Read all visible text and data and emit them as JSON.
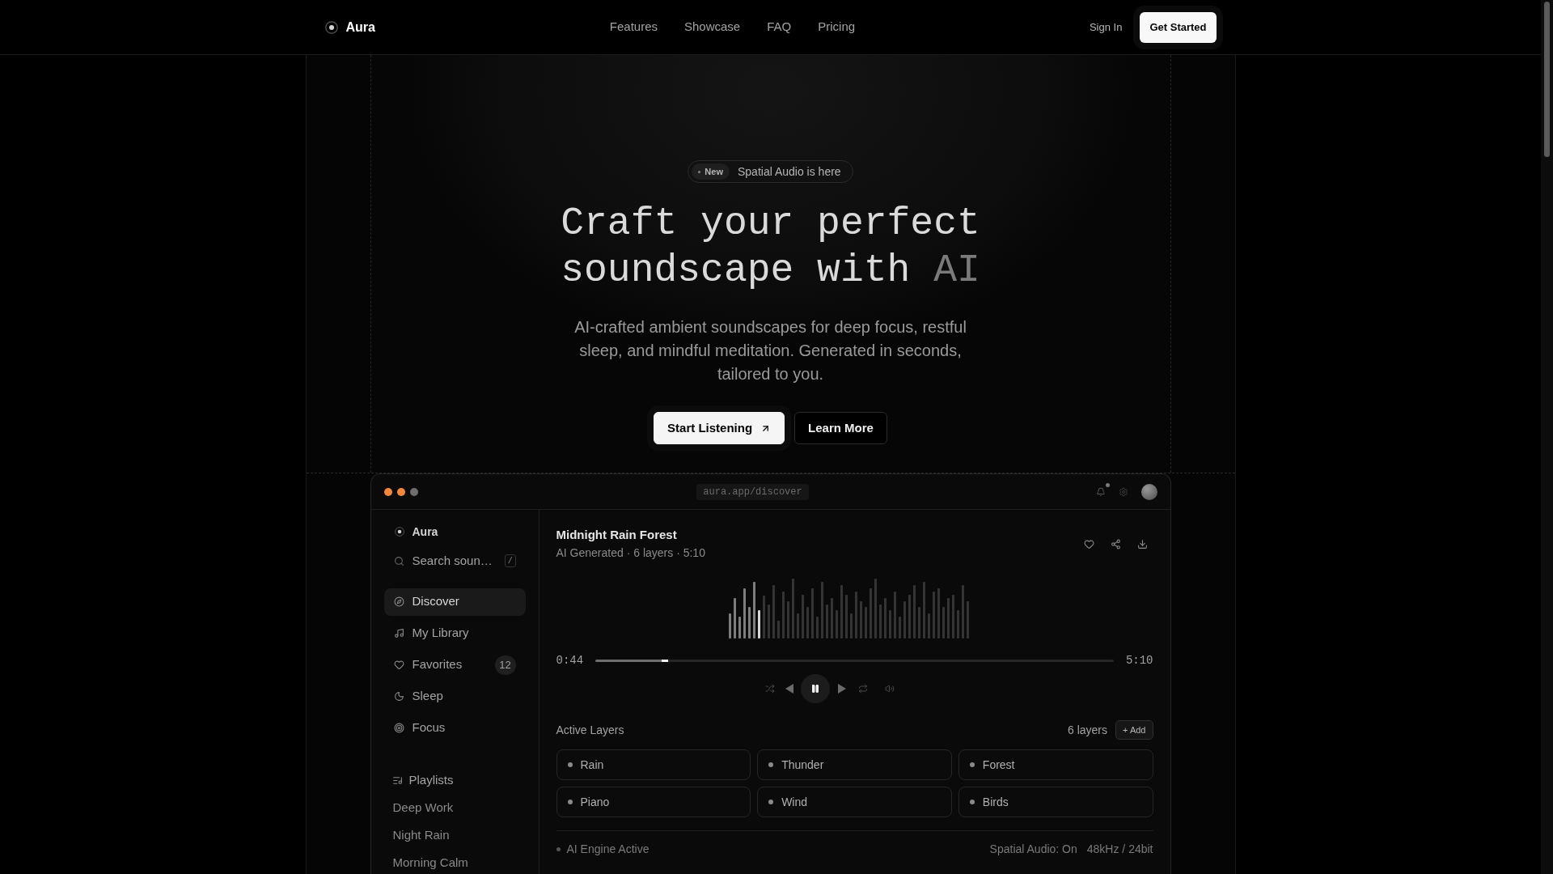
{
  "nav": {
    "brand": "Aura",
    "links": [
      "Features",
      "Showcase",
      "FAQ",
      "Pricing"
    ],
    "sign_in": "Sign In",
    "cta": "Get Started"
  },
  "hero": {
    "badge": {
      "tag": "New",
      "text": "Spatial Audio is here"
    },
    "title": "Craft your perfect soundscape with",
    "title_accent": "AI",
    "subtitle": "AI-crafted ambient soundscapes for deep focus, restful sleep, and mindful meditation. Generated in seconds, tailored to you.",
    "buttons": [
      {
        "label": "Start Listening",
        "kind": "primary"
      },
      {
        "label": "Learn More",
        "kind": "secondary"
      }
    ]
  },
  "app_window": {
    "traffic_lights": [
      {
        "color": "#f5873c"
      },
      {
        "color": "#f5873c"
      },
      {
        "color": "#6e6e6e"
      }
    ],
    "url": "aura.app/discover",
    "notifications_unread": true
  },
  "sidebar": {
    "brand": "Aura",
    "search": {
      "placeholder": "Search soun…",
      "shortcut": "/"
    },
    "items": [
      {
        "label": "Discover",
        "selected": true
      },
      {
        "label": "My Library",
        "selected": false
      },
      {
        "label": "Favorites",
        "count": "12",
        "selected": false
      },
      {
        "label": "Sleep",
        "selected": false
      },
      {
        "label": "Focus",
        "selected": false
      }
    ],
    "playlists": {
      "title": "Playlists",
      "items": [
        "Deep Work",
        "Night Rain",
        "Morning Calm"
      ]
    }
  },
  "player": {
    "title": "Midnight Rain Forest",
    "meta": "AI Generated · 6 layers · 5:10",
    "elapsed": "0:44",
    "duration": "5:10",
    "level": 0.14,
    "playing": true
  },
  "layers": {
    "title": "Active Layers",
    "count": "6 layers",
    "add": "+ Add",
    "items": [
      {
        "name": "Rain"
      },
      {
        "name": "Thunder"
      },
      {
        "name": "Forest"
      },
      {
        "name": "Piano"
      },
      {
        "name": "Wind"
      },
      {
        "name": "Birds"
      }
    ]
  },
  "status": {
    "engine": "AI Engine Active",
    "spatial": "Spatial Audio: On",
    "format": "48kHz / 24bit"
  }
}
